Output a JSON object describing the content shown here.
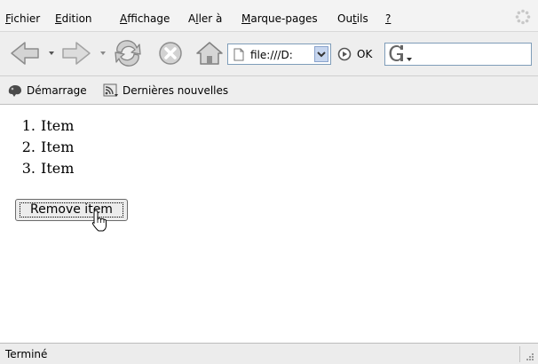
{
  "menu": {
    "items": [
      {
        "pre": "",
        "key": "F",
        "post": "ichier"
      },
      {
        "pre": "",
        "key": "E",
        "post": "dition"
      },
      {
        "pre": "",
        "key": "A",
        "post": "ffichage"
      },
      {
        "pre": "A",
        "key": "l",
        "post": "ler à"
      },
      {
        "pre": "",
        "key": "M",
        "post": "arque-pages"
      },
      {
        "pre": "Ou",
        "key": "t",
        "post": "ils"
      },
      {
        "pre": "",
        "key": "?",
        "post": ""
      }
    ]
  },
  "toolbar": {
    "url": "file:///D:",
    "go_label": "OK",
    "back_icon": "back-arrow-icon",
    "forward_icon": "forward-arrow-icon",
    "reload_icon": "reload-icon",
    "stop_icon": "stop-icon",
    "home_icon": "home-icon",
    "search_engine_icon": "google-icon"
  },
  "bookmarks": {
    "items": [
      {
        "label": "Démarrage",
        "icon": "getting-started-icon"
      },
      {
        "label": "Dernières nouvelles",
        "icon": "rss-feed-icon"
      }
    ]
  },
  "content": {
    "list": [
      {
        "num": "1.",
        "text": "Item"
      },
      {
        "num": "2.",
        "text": "Item"
      },
      {
        "num": "3.",
        "text": "Item"
      }
    ],
    "button_label": "Remove item"
  },
  "status": {
    "text": "Terminé"
  },
  "colors": {
    "chrome_bg": "#eeeeee",
    "field_border": "#7f9db9",
    "icon_gray": "#8c8c8c"
  }
}
